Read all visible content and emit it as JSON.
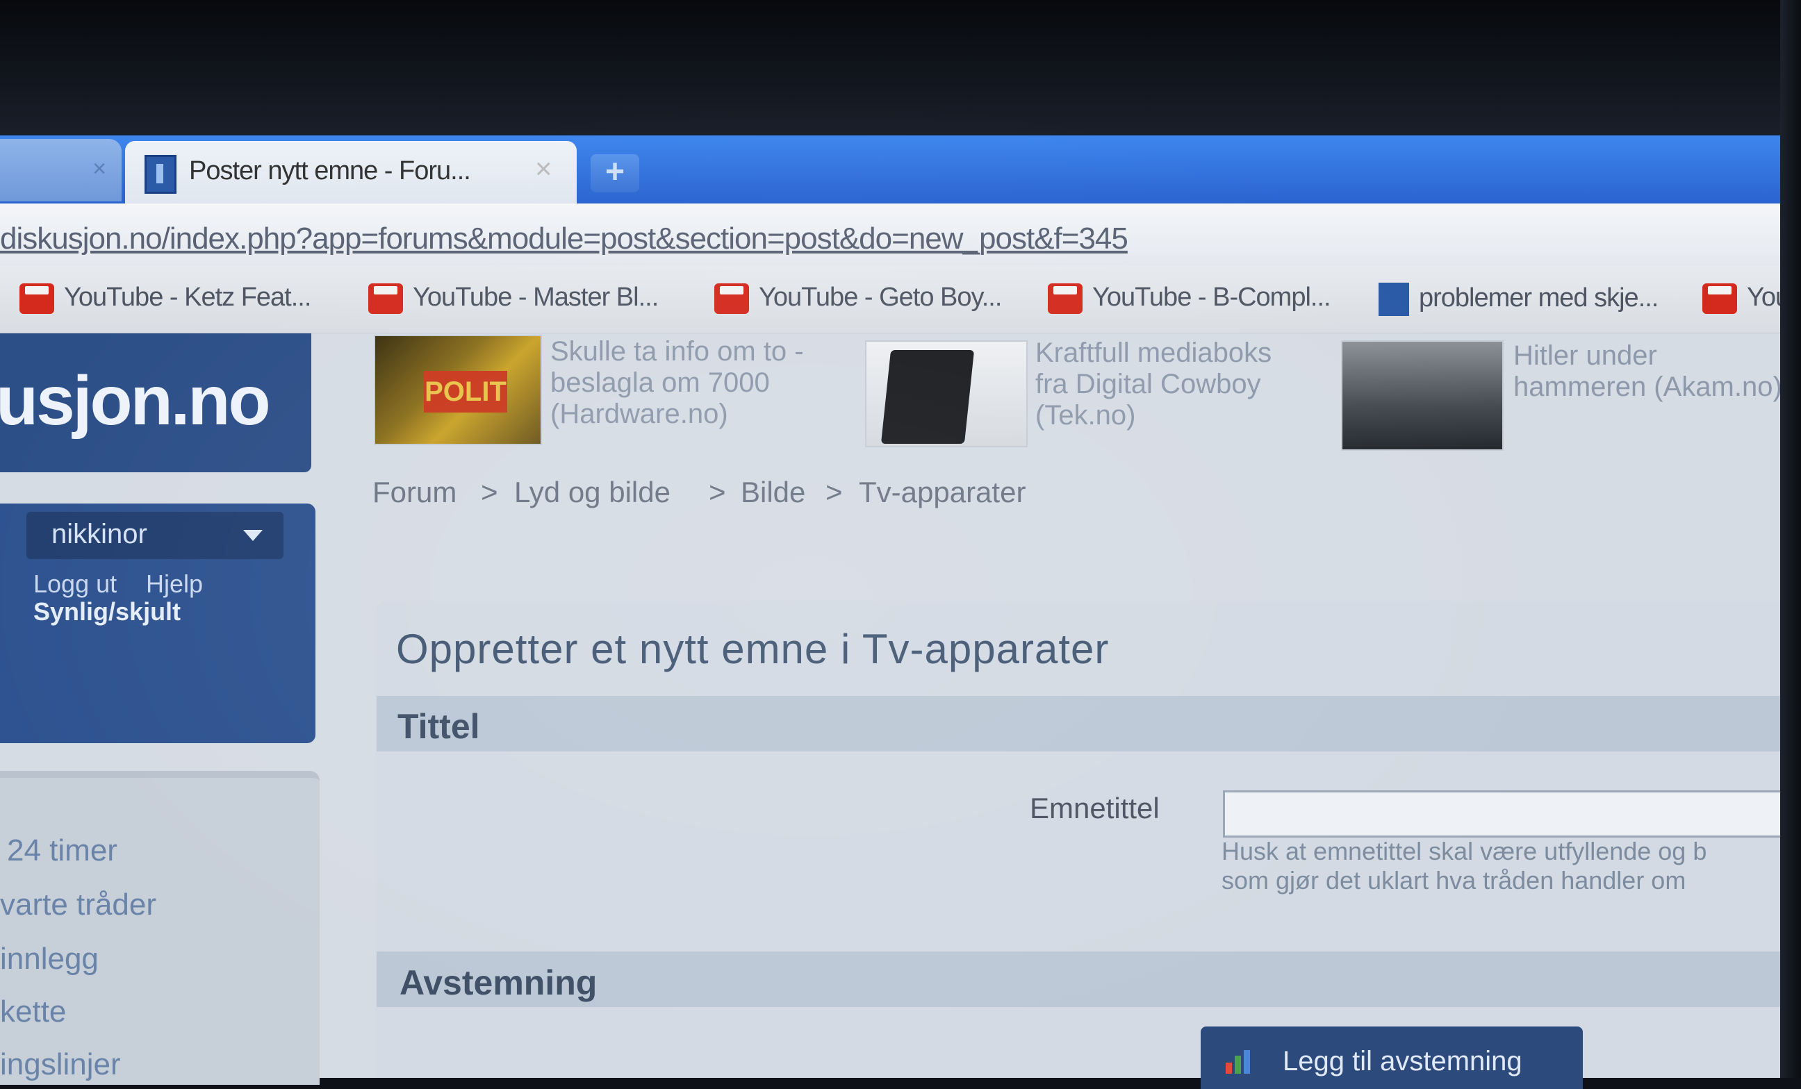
{
  "browser": {
    "active_tab_title": "Poster nytt emne - Foru...",
    "new_tab_symbol": "+",
    "tab_close_symbol": "×",
    "url": "diskusjon.no/index.php?app=forums&module=post&section=post&do=new_post&f=345"
  },
  "bookmarks": [
    {
      "label": "YouTube - Ketz Feat...",
      "icon": "youtube-icon"
    },
    {
      "label": "YouTube - Master Bl...",
      "icon": "youtube-icon"
    },
    {
      "label": "YouTube - Geto Boy...",
      "icon": "youtube-icon"
    },
    {
      "label": "YouTube - B-Compl...",
      "icon": "youtube-icon"
    },
    {
      "label": "problemer med skje...",
      "icon": "forum-icon"
    },
    {
      "label": "YouT",
      "icon": "youtube-icon"
    }
  ],
  "site": {
    "logo_text": "usjon.no"
  },
  "user": {
    "name": "nikkinor",
    "logout": "Logg ut",
    "help": "Hjelp",
    "visibility": "Synlig/skjult"
  },
  "news": [
    {
      "line1": "Skulle ta info om to -",
      "line2": "beslagla om 7000",
      "line3": "(Hardware.no)"
    },
    {
      "line1": "Kraftfull mediaboks",
      "line2": "fra Digital Cowboy",
      "line3": "(Tek.no)"
    },
    {
      "line1": "Hitler under",
      "line2": "hammeren (Akam.no)"
    }
  ],
  "police_thumb_text": "POLIT",
  "breadcrumb": {
    "items": [
      "Forum",
      "Lyd og bilde",
      "Bilde",
      "Tv-apparater"
    ],
    "separator": ">"
  },
  "sidebar_nav": [
    "24 timer",
    "varte tråder",
    "innlegg",
    "kette",
    "ingslinjer"
  ],
  "form": {
    "heading": "Oppretter et nytt emne i Tv-apparater",
    "section_title": "Tittel",
    "field_label": "Emnetittel",
    "field_value": "",
    "hint_line1": "Husk at emnetittel skal være utfyllende og b",
    "hint_line2": "som gjør det uklart hva tråden handler om",
    "section_poll": "Avstemning",
    "poll_button": "Legg til avstemning"
  },
  "colors": {
    "tab_blue": "#2f6fd8",
    "forum_blue": "#2d4f88",
    "youtube_red": "#d42a1e"
  }
}
